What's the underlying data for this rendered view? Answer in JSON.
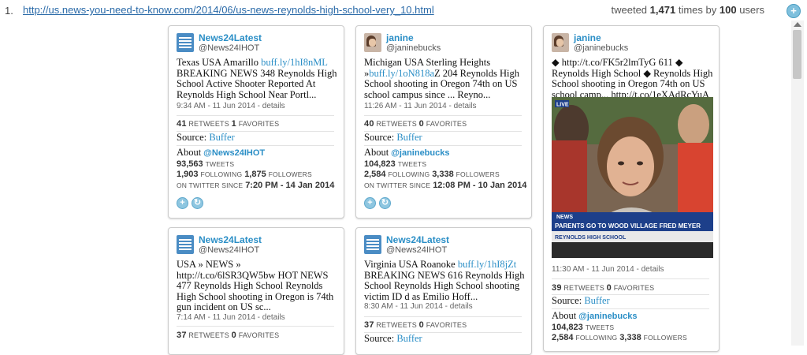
{
  "header": {
    "index": "1.",
    "url": "http://us.news-you-need-to-know.com/2014/06/us-news-reynolds-high-school-very_10.html",
    "stats_prefix": "tweeted",
    "times": "1,471",
    "stats_mid": "times by",
    "users": "100",
    "stats_suffix": "users",
    "add_label": "+"
  },
  "labels": {
    "retweets": "RETWEETS",
    "favorites": "FAVORITES",
    "source": "Source:",
    "about": "About",
    "tweets": "TWEETS",
    "following": "FOLLOWING",
    "followers": "FOLLOWERS",
    "on_twitter_since": "ON TWITTER SINCE",
    "add": "+",
    "reply": "↻"
  },
  "cards": [
    {
      "name": "News24Latest",
      "handle": "@News24IHOT",
      "text_a": "Texas USA Amarillo ",
      "link": "buff.ly/1hI8nML",
      "text_b": " BREAKING NEWS 348 Reynolds High School Active Shooter Reported At Reynolds High School Near Portl...",
      "time": "9:34 AM - 11 Jun 2014 - details",
      "retweets": "41",
      "favorites": "1",
      "source": "Buffer",
      "about_handle": "@News24IHOT",
      "tweets": "93,563",
      "following": "1,903",
      "followers": "1,875",
      "since": "7:20 PM - 14 Jan 2014"
    },
    {
      "name": "janine",
      "handle": "@janinebucks",
      "text_a": "Michigan USA Sterling Heights »",
      "link": "buff.ly/1oN818a",
      "text_b": "Z 204 Reynolds High School shooting in Oregon 74th on US school campus since ... Reyno...",
      "time": "11:26 AM - 11 Jun 2014 - details",
      "retweets": "40",
      "favorites": "0",
      "source": "Buffer",
      "about_handle": "@janinebucks",
      "tweets": "104,823",
      "following": "2,584",
      "followers": "3,338",
      "since": "12:08 PM - 10 Jan 2014"
    },
    {
      "name": "janine",
      "handle": "@janinebucks",
      "text_a": "◆ http://t.co/FK5r2lmTyG 611 ◆ Reynolds High School ◆ Reynolds High School shooting in Oregon 74th on US school camp... http://t.co/1eXAdRcYuA",
      "link": "",
      "text_b": "",
      "time": "11:30 AM - 11 Jun 2014 - details",
      "retweets": "39",
      "favorites": "0",
      "source": "Buffer",
      "about_handle": "@janinebucks",
      "tweets": "104,823",
      "following": "2,584",
      "followers": "3,338",
      "photo_banner": "PARENTS GO TO WOOD VILLAGE FRED MEYER",
      "photo_sub": "REYNOLDS HIGH SCHOOL",
      "photo_tag": "LIVE",
      "photo_news": "NEWS"
    },
    {
      "name": "News24Latest",
      "handle": "@News24IHOT",
      "text_a": "USA » NEWS » http://t.co/6lSR3QW5bw HOT NEWS 477 Reynolds High School Reynolds High School shooting in Oregon is 74th gun incident on US sc...",
      "link": "",
      "text_b": "",
      "time": "7:14 AM - 11 Jun 2014 - details",
      "retweets": "37",
      "favorites": "0"
    },
    {
      "name": "News24Latest",
      "handle": "@News24IHOT",
      "text_a": "Virginia USA Roanoke ",
      "link": "buff.ly/1hI8jZt",
      "text_b": " BREAKING NEWS 616 Reynolds High School Reynolds High School shooting victim ID d as Emilio Hoff...",
      "time": "8:30 AM - 11 Jun 2014 - details",
      "retweets": "37",
      "favorites": "0",
      "source": "Buffer"
    }
  ],
  "colors": {
    "link": "#2a8ec6",
    "url": "#2a6aa8",
    "border": "#cccccc"
  },
  "icons": {
    "add": "plus-circle-icon",
    "retweet": "retweet-icon",
    "news_avatar": "newspaper-icon"
  }
}
